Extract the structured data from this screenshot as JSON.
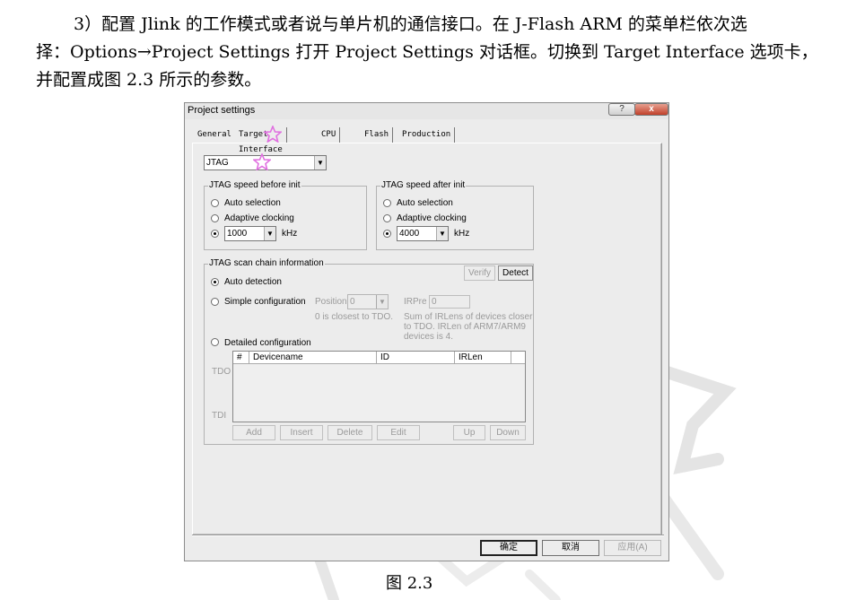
{
  "paragraph": {
    "line1": "3）配置 Jlink 的工作模式或者说与单片机的通信接口。在 J-Flash ARM 的菜单栏依次选",
    "line2": "择：Options→Project Settings 打开 Project Settings 对话框。切换到 Target Interface 选项卡，",
    "line3": "并配置成图 2.3 所示的参数。"
  },
  "dialog": {
    "title": "Project settings",
    "help_label": "?",
    "close_label": "x",
    "tabs": [
      {
        "label": "General"
      },
      {
        "label": "Target Interface",
        "active": true
      },
      {
        "label": "CPU"
      },
      {
        "label": "Flash"
      },
      {
        "label": "Production"
      }
    ],
    "interface_select": {
      "value": "JTAG"
    },
    "speed_before": {
      "legend": "JTAG speed before init",
      "options": [
        "Auto selection",
        "Adaptive clocking"
      ],
      "selected_value": "1000",
      "unit": "kHz"
    },
    "speed_after": {
      "legend": "JTAG speed after init",
      "options": [
        "Auto selection",
        "Adaptive clocking"
      ],
      "selected_value": "4000",
      "unit": "kHz"
    },
    "scan_chain": {
      "legend": "JTAG scan chain information",
      "verify_label": "Verify",
      "detect_label": "Detect",
      "auto_detection": "Auto detection",
      "simple_config": "Simple configuration",
      "position_label": "Position",
      "position_value": "0",
      "position_note": "0 is closest to TDO.",
      "irpre_label": "IRPre",
      "irpre_value": "0",
      "irpre_note_1": "Sum of IRLens of devices closer",
      "irpre_note_2": "to TDO. IRLen of ARM7/ARM9",
      "irpre_note_3": "devices is 4.",
      "detailed_config": "Detailed configuration",
      "columns": [
        "#",
        "Devicename",
        "ID",
        "IRLen"
      ],
      "tdo_label": "TDO",
      "tdi_label": "TDI",
      "buttons": [
        "Add",
        "Insert",
        "Delete",
        "Edit",
        "Up",
        "Down"
      ]
    },
    "ok_label": "确定",
    "cancel_label": "取消",
    "apply_label": "应用(A)"
  },
  "caption": "图 2.3",
  "colors": {
    "star_pink": "#e070e0",
    "close_red": "#c0402a"
  }
}
